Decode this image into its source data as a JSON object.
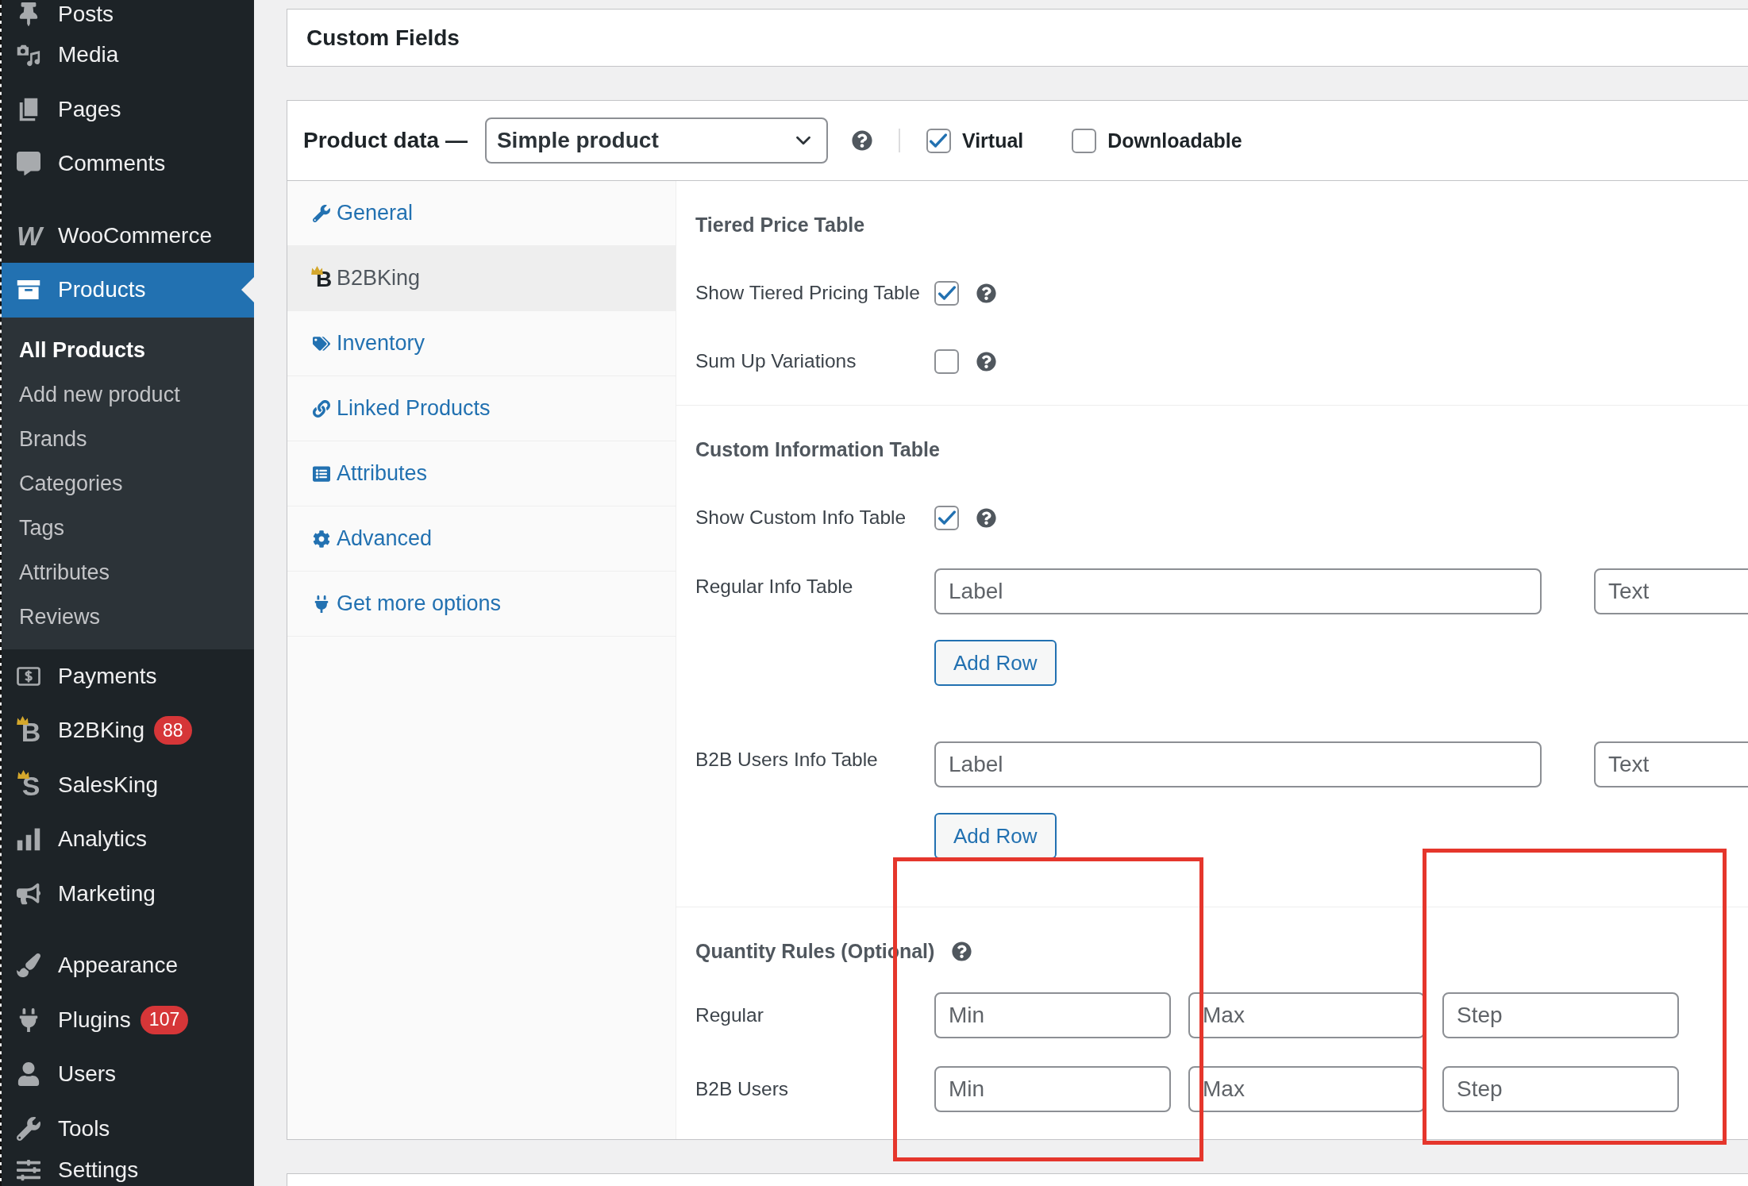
{
  "sidebar": {
    "groups": [
      {
        "items": [
          {
            "label": "Posts",
            "selected": false
          },
          {
            "label": "Media",
            "selected": false
          },
          {
            "label": "Pages",
            "selected": false
          },
          {
            "label": "Comments",
            "selected": false
          }
        ]
      },
      {
        "items": [
          {
            "label": "WooCommerce",
            "selected": false,
            "icon_text": "W"
          },
          {
            "label": "Products",
            "selected": true,
            "children": [
              {
                "label": "All Products",
                "selected": true
              },
              {
                "label": "Add new product",
                "selected": false
              },
              {
                "label": "Brands",
                "selected": false
              },
              {
                "label": "Categories",
                "selected": false
              },
              {
                "label": "Tags",
                "selected": false
              },
              {
                "label": "Attributes",
                "selected": false
              },
              {
                "label": "Reviews",
                "selected": false
              }
            ]
          },
          {
            "label": "Payments",
            "selected": false
          },
          {
            "label": "B2BKing",
            "selected": false,
            "icon_text": "B",
            "badge": "88"
          },
          {
            "label": "SalesKing",
            "selected": false,
            "icon_text": "S"
          },
          {
            "label": "Analytics",
            "selected": false
          },
          {
            "label": "Marketing",
            "selected": false
          }
        ]
      },
      {
        "items": [
          {
            "label": "Appearance",
            "selected": false
          },
          {
            "label": "Plugins",
            "selected": false,
            "badge": "107"
          },
          {
            "label": "Users",
            "selected": false
          },
          {
            "label": "Tools",
            "selected": false
          },
          {
            "label": "Settings",
            "selected": false
          }
        ]
      }
    ]
  },
  "custom_fields": {
    "title": "Custom Fields"
  },
  "product_data": {
    "title": "Product data —",
    "product_type": {
      "value": "Simple product"
    },
    "options": [
      {
        "label": "Virtual",
        "checked": true
      },
      {
        "label": "Downloadable",
        "checked": false
      }
    ],
    "tabs": [
      {
        "label": "General",
        "selected": false
      },
      {
        "label": "B2BKing",
        "selected": true,
        "icon_text": "B"
      },
      {
        "label": "Inventory",
        "selected": false
      },
      {
        "label": "Linked Products",
        "selected": false
      },
      {
        "label": "Attributes",
        "selected": false
      },
      {
        "label": "Advanced",
        "selected": false
      },
      {
        "label": "Get more options",
        "selected": false
      }
    ],
    "panel": {
      "sections": [
        {
          "title": "Tiered Price Table",
          "rows": [
            {
              "kind": "checkbox",
              "label": "Show Tiered Pricing Table",
              "checked": true,
              "help": true
            },
            {
              "kind": "checkbox",
              "label": "Sum Up Variations",
              "checked": false,
              "help": true
            }
          ]
        },
        {
          "title": "Custom Information Table",
          "rows": [
            {
              "kind": "checkbox",
              "label": "Show Custom Info Table",
              "checked": true,
              "help": true
            },
            {
              "kind": "info_table",
              "label": "Regular Info Table",
              "fields": [
                {
                  "placeholder": "Label"
                },
                {
                  "placeholder": "Text"
                }
              ],
              "button": "Add Row"
            },
            {
              "kind": "info_table",
              "label": "B2B Users Info Table",
              "fields": [
                {
                  "placeholder": "Label"
                },
                {
                  "placeholder": "Text"
                }
              ],
              "button": "Add Row"
            }
          ]
        },
        {
          "title": "Quantity Rules (Optional)",
          "help": true,
          "rows": [
            {
              "kind": "inputs",
              "label": "Regular",
              "fields": [
                {
                  "placeholder": "Min"
                },
                {
                  "placeholder": "Max"
                },
                {
                  "placeholder": "Step"
                }
              ]
            },
            {
              "kind": "inputs",
              "label": "B2B Users",
              "fields": [
                {
                  "placeholder": "Min"
                },
                {
                  "placeholder": "Max"
                },
                {
                  "placeholder": "Step"
                }
              ]
            }
          ]
        }
      ]
    }
  },
  "annotations": [
    {
      "kind": "frame"
    },
    {
      "kind": "frame"
    }
  ]
}
